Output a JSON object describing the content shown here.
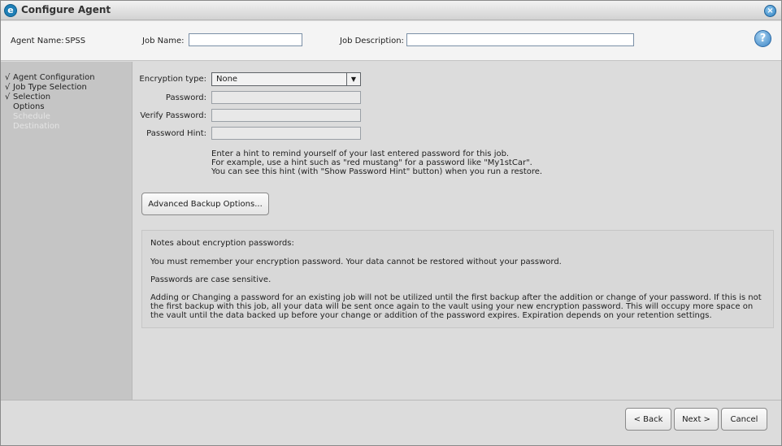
{
  "window": {
    "title": "Configure Agent",
    "app_icon": "e-logo-icon",
    "close_icon": "close-icon"
  },
  "header": {
    "agent_name_label": "Agent Name:",
    "agent_name_value": "SPSS",
    "job_name_label": "Job Name:",
    "job_name_value": "",
    "job_description_label": "Job Description:",
    "job_description_value": "",
    "help_glyph": "?"
  },
  "sidebar": {
    "steps": [
      {
        "check": "√",
        "label": "Agent Configuration"
      },
      {
        "check": "√",
        "label": "Job Type Selection"
      },
      {
        "check": "√",
        "label": "Selection"
      },
      {
        "check": "",
        "label": "Options"
      },
      {
        "check": "",
        "label": "Schedule"
      },
      {
        "check": "",
        "label": "Destination"
      }
    ]
  },
  "form": {
    "encryption_type_label": "Encryption type:",
    "encryption_type_value": "None",
    "password_label": "Password:",
    "verify_password_label": "Verify Password:",
    "password_hint_label": "Password Hint:",
    "hint_lines": [
      "Enter a hint to remind yourself of your last entered password for this job.",
      "For example, use a hint such as \"red mustang\" for a password like \"My1stCar\".",
      "You can see this hint (with \"Show Password Hint\" button) when you run a restore."
    ],
    "advanced_button": "Advanced Backup Options..."
  },
  "notes": {
    "title": "Notes about encryption passwords:",
    "line1": "You must remember your encryption password. Your data cannot be restored without your password.",
    "line2": "Passwords are case sensitive.",
    "line3": "Adding or Changing a password for an existing job will not be utilized until the first backup after the addition or change of your password. If this is not the first backup with this job, all your data will be sent once again to the vault using your new encryption password. This will occupy more space on the vault until the data backed up before your change or addition of the password expires. Expiration depends on your retention settings."
  },
  "footer": {
    "back_label": "< Back",
    "next_label": "Next >",
    "cancel_label": "Cancel"
  }
}
